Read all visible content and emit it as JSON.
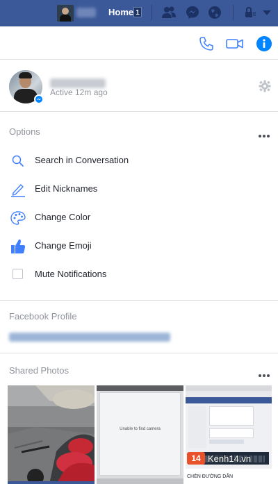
{
  "topbar": {
    "home_label": "Home",
    "home_badge": "1"
  },
  "profile": {
    "status": "Active 12m ago"
  },
  "options": {
    "title": "Options",
    "items": [
      {
        "label": "Search in Conversation",
        "icon": "search-icon"
      },
      {
        "label": "Edit Nicknames",
        "icon": "pencil-icon"
      },
      {
        "label": "Change Color",
        "icon": "palette-icon"
      },
      {
        "label": "Change Emoji",
        "icon": "thumbs-up-icon"
      },
      {
        "label": "Mute Notifications",
        "icon": "checkbox"
      }
    ]
  },
  "facebook_profile": {
    "title": "Facebook Profile"
  },
  "shared_photos": {
    "title": "Shared Photos",
    "photo2_text": "Unable to find camera",
    "photo3_watermark": "Kenh14.vn",
    "photo3_badge": "14",
    "photo3_caption": "CHÈN ĐƯỜNG DẪN"
  },
  "colors": {
    "topbar": "#3b5998",
    "accent": "#0084ff",
    "icon_blue": "#4080ff"
  }
}
